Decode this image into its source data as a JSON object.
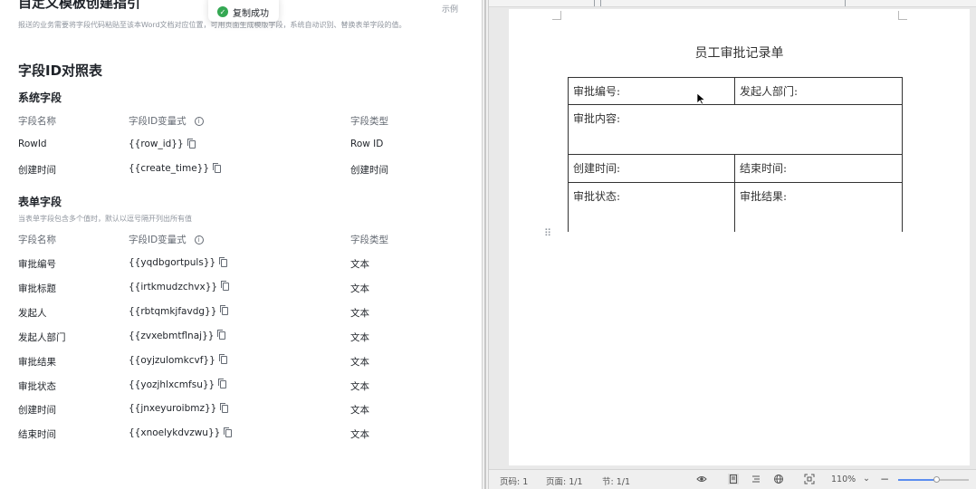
{
  "left": {
    "doc_title": "自定义模板创建指引",
    "doc_tag": "示例",
    "doc_desc": "报送的业务需要将字段代码粘贴至该本Word文档对应位置，可用页面生成模版字段，系统自动识别、替换表单字段的值。",
    "toast": {
      "text": "复制成功"
    },
    "section_title": "字段ID对照表",
    "system": {
      "title": "系统字段",
      "header": {
        "name": "字段名称",
        "var": "字段ID变量式",
        "type": "字段类型"
      },
      "rows": [
        {
          "name": "RowId",
          "var": "{{row_id}}",
          "type": "Row ID"
        },
        {
          "name": "创建时间",
          "var": "{{create_time}}",
          "type": "创建时间"
        }
      ]
    },
    "form": {
      "title": "表单字段",
      "note": "当表单字段包含多个值时，默认以逗号隔开列出所有值",
      "header": {
        "name": "字段名称",
        "var": "字段ID变量式",
        "type": "字段类型"
      },
      "rows": [
        {
          "name": "审批编号",
          "var": "{{yqdbgortpuls}}",
          "type": "文本"
        },
        {
          "name": "审批标题",
          "var": "{{irtkmudzchvx}}",
          "type": "文本"
        },
        {
          "name": "发起人",
          "var": "{{rbtqmkjfavdg}}",
          "type": "文本"
        },
        {
          "name": "发起人部门",
          "var": "{{zvxebmtflnaj}}",
          "type": "文本"
        },
        {
          "name": "审批结果",
          "var": "{{oyjzulomkcvf}}",
          "type": "文本"
        },
        {
          "name": "审批状态",
          "var": "{{yozjhlxcmfsu}}",
          "type": "文本"
        },
        {
          "name": "创建时间",
          "var": "{{jnxeyuroibmz}}",
          "type": "文本"
        },
        {
          "name": "结束时间",
          "var": "{{xnoelykdvzwu}}",
          "type": "文本"
        }
      ]
    }
  },
  "document": {
    "title": "员工审批记录单",
    "cells": {
      "approval_no": "审批编号:",
      "dept": "发起人部门:",
      "content": "审批内容:",
      "created": "创建时间:",
      "ended": "结束时间:",
      "status": "审批状态:",
      "result": "审批结果:"
    }
  },
  "statusbar": {
    "page_no": "页码: 1",
    "page_count": "页面: 1/1",
    "section": "节: 1/1",
    "zoom": "110%",
    "zoom_fraction": 0.55
  },
  "colors": {
    "toast_success": "#34a853",
    "zoom_accent": "#5b8def"
  }
}
